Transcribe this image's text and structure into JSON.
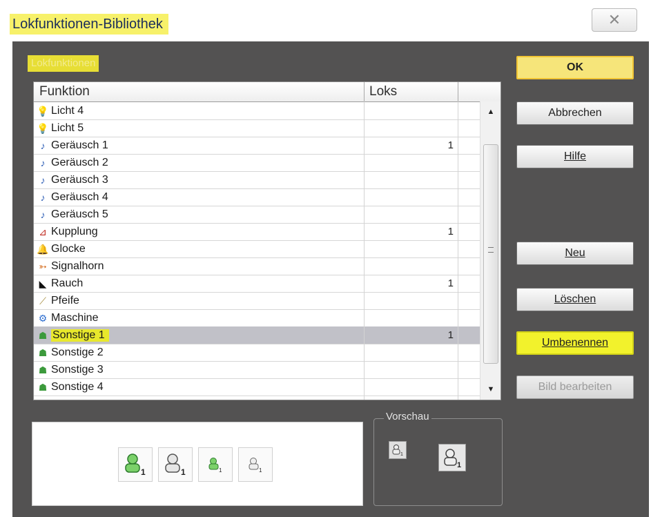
{
  "window": {
    "title": "Lokfunktionen-Bibliothek"
  },
  "group_label": "Lokfunktionen",
  "list": {
    "columns": [
      "Funktion",
      "Loks"
    ],
    "rows": [
      {
        "name": "Licht 4",
        "loks": "",
        "icon": "light-icon",
        "icon_glyph": "💡"
      },
      {
        "name": "Licht 5",
        "loks": "",
        "icon": "light-icon",
        "icon_glyph": "💡"
      },
      {
        "name": "Geräusch 1",
        "loks": "1",
        "icon": "sound-note-icon",
        "icon_glyph": "♪"
      },
      {
        "name": "Geräusch 2",
        "loks": "",
        "icon": "sound-note-icon",
        "icon_glyph": "♪"
      },
      {
        "name": "Geräusch 3",
        "loks": "",
        "icon": "sound-note-icon",
        "icon_glyph": "♪"
      },
      {
        "name": "Geräusch 4",
        "loks": "",
        "icon": "sound-note-icon",
        "icon_glyph": "♪"
      },
      {
        "name": "Geräusch 5",
        "loks": "",
        "icon": "sound-note-icon",
        "icon_glyph": "♪"
      },
      {
        "name": "Kupplung",
        "loks": "1",
        "icon": "coupling-icon",
        "icon_glyph": "⊿"
      },
      {
        "name": "Glocke",
        "loks": "",
        "icon": "bell-icon",
        "icon_glyph": "🔔"
      },
      {
        "name": "Signalhorn",
        "loks": "",
        "icon": "horn-icon",
        "icon_glyph": "➳"
      },
      {
        "name": "Rauch",
        "loks": "1",
        "icon": "smoke-icon",
        "icon_glyph": "◣"
      },
      {
        "name": "Pfeife",
        "loks": "",
        "icon": "whistle-icon",
        "icon_glyph": "⟋"
      },
      {
        "name": "Maschine",
        "loks": "",
        "icon": "machine-gear-icon",
        "icon_glyph": "⚙"
      },
      {
        "name": "Sonstige 1",
        "loks": "1",
        "icon": "generic-user-icon",
        "icon_glyph": "☗",
        "selected": true
      },
      {
        "name": "Sonstige 2",
        "loks": "",
        "icon": "generic-user-icon",
        "icon_glyph": "☗"
      },
      {
        "name": "Sonstige 3",
        "loks": "",
        "icon": "generic-user-icon",
        "icon_glyph": "☗"
      },
      {
        "name": "Sonstige 4",
        "loks": "",
        "icon": "generic-user-icon",
        "icon_glyph": "☗"
      }
    ]
  },
  "buttons": {
    "ok": "OK",
    "abbrechen": "Abbrechen",
    "hilfe": "Hilfe",
    "neu": "Neu",
    "loeschen": "Löschen",
    "umbenennen": "Umbenennen",
    "bild_bearbeiten": "Bild bearbeiten"
  },
  "preview": {
    "label": "Vorschau"
  },
  "colors": {
    "title_highlight": "#f7f16a",
    "dialog_bg": "#535252",
    "ok_button": "#f6e57a",
    "umbenennen_button": "#f2f22c",
    "selected_row": "#c1c1c8"
  }
}
